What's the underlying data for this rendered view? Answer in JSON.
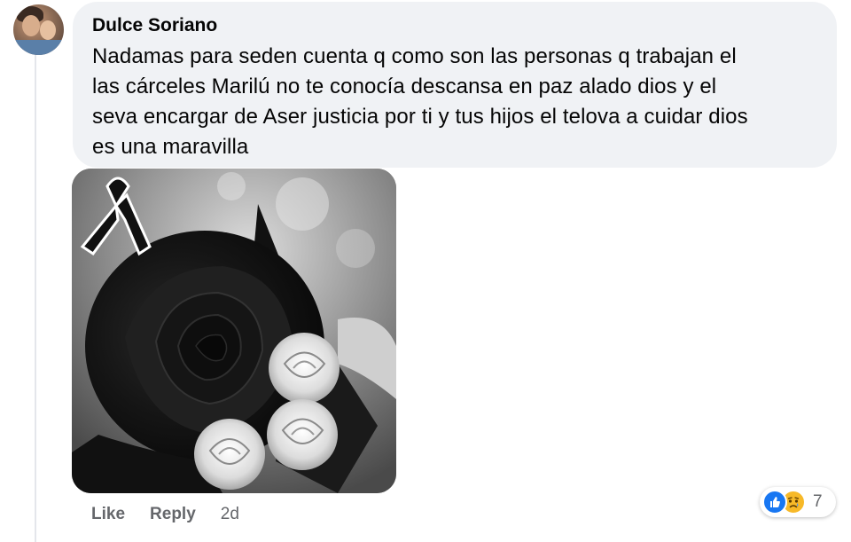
{
  "comment": {
    "author": "Dulce Soriano",
    "text": "Nadamas para seden cuenta q como son las personas q trabajan el las cárceles Marilú no te conocía descansa en paz alado dios y el seva encargar de Aser justicia por ti y tus hijos el telova a cuidar dios es una maravilla",
    "text_lines": [
      "Nadamas para seden cuenta q como son las personas q trabajan el",
      "las cárceles Marilú no te conocía descansa en paz alado dios y el",
      "seva encargar de Aser justicia por ti y tus hijos el telova a cuidar dios",
      "es una maravilla"
    ],
    "attachment_icon": "mourning-rose-image"
  },
  "actions": {
    "like_label": "Like",
    "reply_label": "Reply",
    "time": "2d"
  },
  "reactions": {
    "icons": [
      "like-icon",
      "sad-icon"
    ],
    "count": "7"
  },
  "colors": {
    "bubble_bg": "#f0f2f5",
    "meta_text": "#65676b",
    "like_blue": "#1877f2",
    "sad_yellow": "#f7b928"
  }
}
